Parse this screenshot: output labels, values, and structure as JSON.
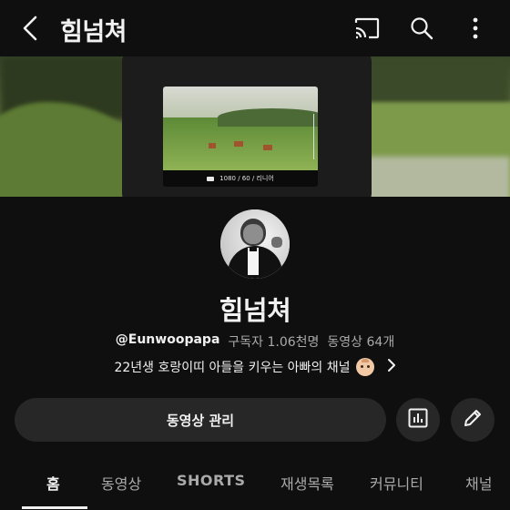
{
  "header": {
    "title": "힘넘쳐",
    "icons": [
      "back-arrow-icon",
      "cast-icon",
      "search-icon",
      "more-vert-icon"
    ]
  },
  "banner": {
    "camera_overlay_text": "1080 / 60 / 리니어"
  },
  "channel": {
    "name": "힘넘쳐",
    "handle": "@Eunwoopapa",
    "subscribers": "구독자 1.06천명",
    "videos": "동영상 64개",
    "description": "22년생 호랑이띠 아들을 키우는 아빠의 채널"
  },
  "actions": {
    "manage_label": "동영상 관리",
    "icons": [
      "analytics-icon",
      "edit-pencil-icon"
    ]
  },
  "tabs": [
    {
      "label": "홈",
      "active": true
    },
    {
      "label": "동영상",
      "active": false
    },
    {
      "label": "SHORTS",
      "active": false
    },
    {
      "label": "재생목록",
      "active": false
    },
    {
      "label": "커뮤니티",
      "active": false
    },
    {
      "label": "채널",
      "active": false
    }
  ],
  "colors": {
    "background": "#0f0f0f",
    "button_bg": "#272727",
    "text_primary": "#f1f1f1",
    "text_secondary": "#aaaaaa"
  }
}
